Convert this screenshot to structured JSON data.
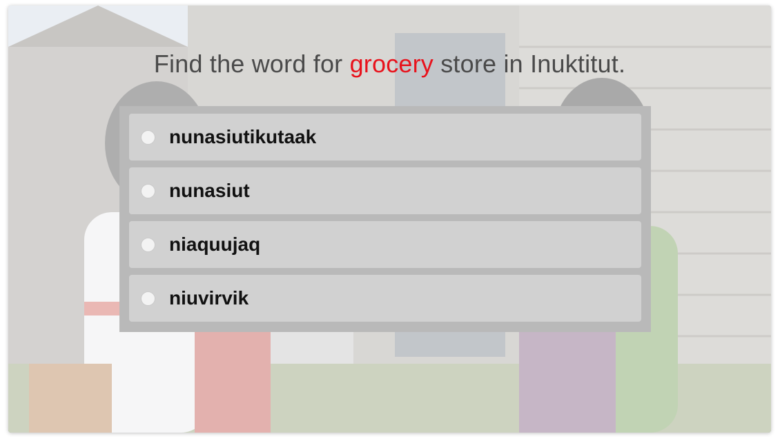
{
  "question": {
    "prefix": "Find the word for ",
    "highlight": "grocery",
    "suffix": " store in Inuktitut."
  },
  "options": [
    {
      "label": "nunasiutikutaak",
      "selected": false
    },
    {
      "label": "nunasiut",
      "selected": false
    },
    {
      "label": "niaquujaq",
      "selected": false
    },
    {
      "label": "niuvirvik",
      "selected": false
    }
  ],
  "colors": {
    "highlight": "#e8121c",
    "question_text": "#4a4a4a",
    "panel": "#b9b9b9",
    "option_bg": "#d1d1d1"
  }
}
